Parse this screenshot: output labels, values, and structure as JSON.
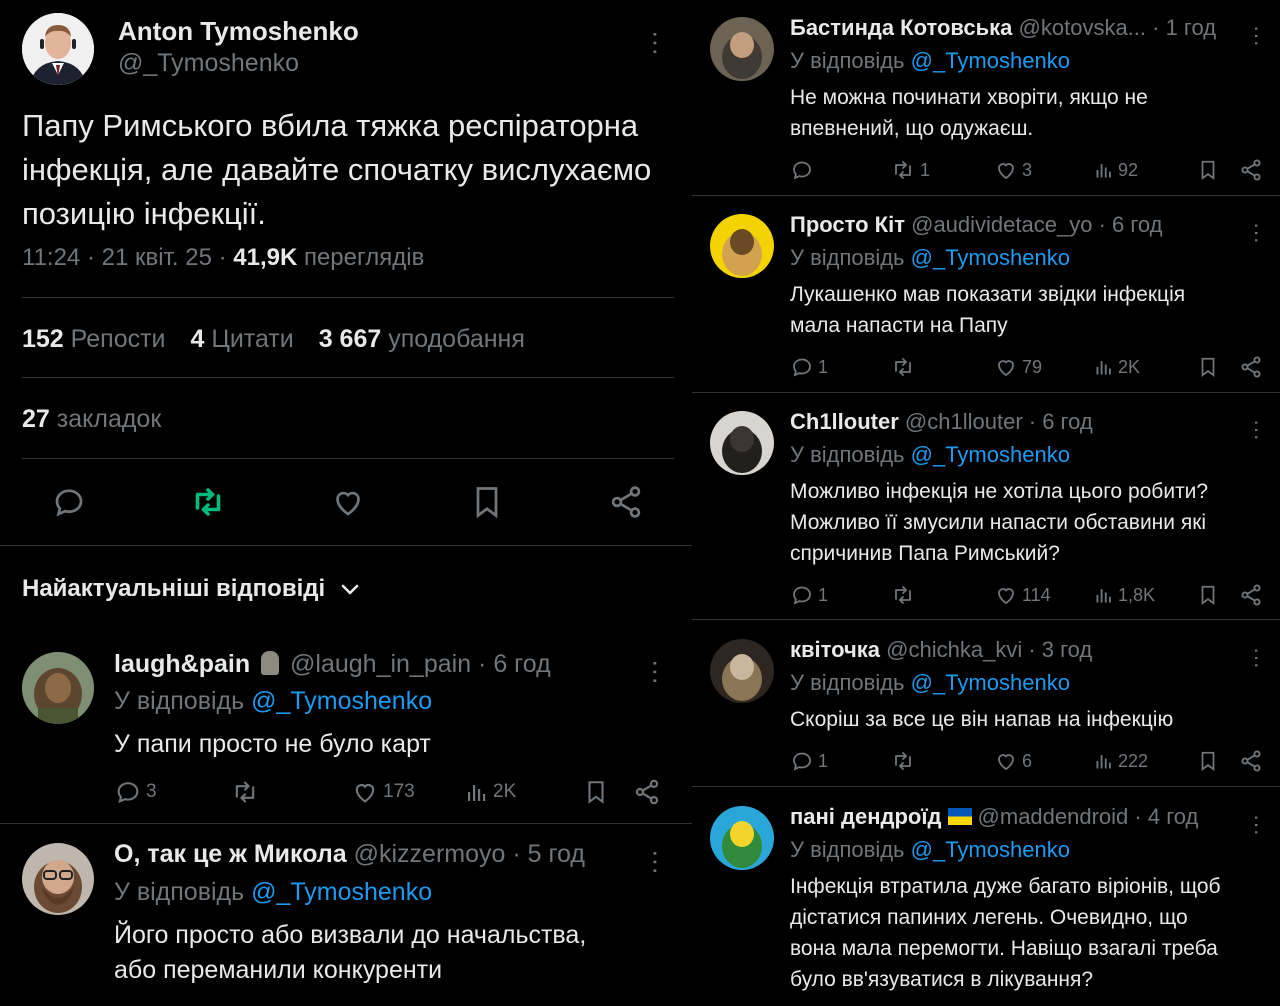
{
  "main_tweet": {
    "author_name": "Anton Tymoshenko",
    "author_handle": "@_Tymoshenko",
    "text": "Папу Римського вбила тяжка респіраторна інфекція, але давайте спочатку вислухаємо позицію інфекції.",
    "time": "11:24 · 21 квіт. 25 · ",
    "views_count": "41,9K",
    "views_label": " переглядів",
    "reposts_count": "152",
    "reposts_label": "Репости",
    "quotes_count": "4",
    "quotes_label": "Цитати",
    "likes_count": "3 667",
    "likes_label": "уподобання",
    "bookmarks_count": "27",
    "bookmarks_label": "закладок"
  },
  "sort_label": "Найактуальніші відповіді",
  "reply_prefix": "У відповідь ",
  "reply_to": "@_Tymoshenko",
  "left_replies": [
    {
      "name": "laugh&pain",
      "handle": "@laugh_in_pain",
      "time": " · 6 год",
      "text": "У папи просто не було карт",
      "replies": "3",
      "retweets": "",
      "likes": "173",
      "views": "2K"
    },
    {
      "name": "О, так це ж Микола",
      "handle": "@kizzermoyo",
      "time": " · 5 год",
      "text_lines": [
        "Його просто або визвали до начальства,",
        "або переманили конкуренти"
      ]
    }
  ],
  "right_replies": [
    {
      "name": "Бастинда Котовська",
      "handle": "@kotovska...",
      "time": " · 1 год",
      "text_lines": [
        "Не можна починати хворіти, якщо не",
        "впевнений, що одужаєш."
      ],
      "replies": "",
      "retweets": "1",
      "likes": "3",
      "views": "92"
    },
    {
      "name": "Просто Кіт",
      "handle": "@audividetace_yo",
      "time": " · 6 год",
      "text_lines": [
        "Лукашенко мав показати звідки інфекція",
        "мала напасти на Папу"
      ],
      "replies": "1",
      "retweets": "",
      "likes": "79",
      "views": "2K"
    },
    {
      "name": "Ch1llouter",
      "handle": "@ch1llouter",
      "time": " · 6 год",
      "text_lines": [
        "Можливо інфекція не хотіла цього робити?",
        "Можливо її змусили напасти обставини які",
        "спричинив Папа Римський?"
      ],
      "replies": "1",
      "retweets": "",
      "likes": "114",
      "views": "1,8K"
    },
    {
      "name": "квіточка",
      "handle": "@chichka_kvi",
      "time": " · 3 год",
      "text_lines": [
        "Скоріш за все це він напав на інфекцію"
      ],
      "replies": "1",
      "retweets": "",
      "likes": "6",
      "views": "222"
    },
    {
      "name": "пані дендроїд",
      "handle": "@maddendroid",
      "time": " · 4 год",
      "text_lines": [
        "Інфекція втратила дуже багато віріонів, щоб",
        "дістатися папиних легень. Очевидно, що",
        "вона мала перемогти. Навіщо взагалі треба",
        "було вв'язуватися в лікування?"
      ]
    }
  ],
  "colors": {
    "background": "#000000",
    "text": "#e7e9ea",
    "muted": "#71767b",
    "link": "#1d9bf0",
    "retweet_active": "#00ba7c",
    "divider": "#2f3336"
  }
}
